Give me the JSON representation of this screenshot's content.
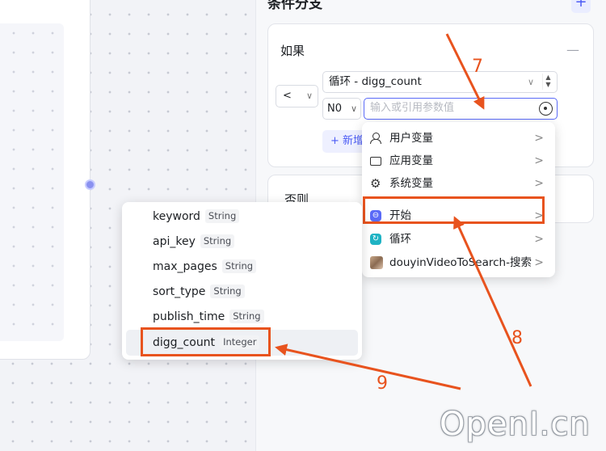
{
  "panel": {
    "title": "条件分支",
    "add_branch_symbol": "+",
    "if_label": "如果",
    "collapse_symbol": "—",
    "operator": "<",
    "variable": "循环 - digg_count",
    "value_type": "N0",
    "value_placeholder": "输入或引用参数值",
    "add_condition_label": "+ 新增",
    "else_label": "否则"
  },
  "source_menu": {
    "items": [
      {
        "label": "用户变量",
        "icon": "user-icon"
      },
      {
        "label": "应用变量",
        "icon": "folder-icon"
      },
      {
        "label": "系统变量",
        "icon": "gear-icon"
      },
      {
        "label": "开始",
        "icon": "start-icon"
      },
      {
        "label": "循环",
        "icon": "loop-icon"
      },
      {
        "label": "douyinVideoToSearch-搜索",
        "icon": "avatar-icon"
      }
    ],
    "chevron": ">"
  },
  "output_menu": {
    "items": [
      {
        "name": "keyword",
        "type": "String"
      },
      {
        "name": "api_key",
        "type": "String"
      },
      {
        "name": "max_pages",
        "type": "String"
      },
      {
        "name": "sort_type",
        "type": "String"
      },
      {
        "name": "publish_time",
        "type": "String"
      },
      {
        "name": "digg_count",
        "type": "Integer"
      }
    ]
  },
  "annotations": {
    "step7": "7",
    "step8": "8",
    "step9": "9",
    "color": "#e8531e"
  },
  "watermark": "OpenI.cn"
}
